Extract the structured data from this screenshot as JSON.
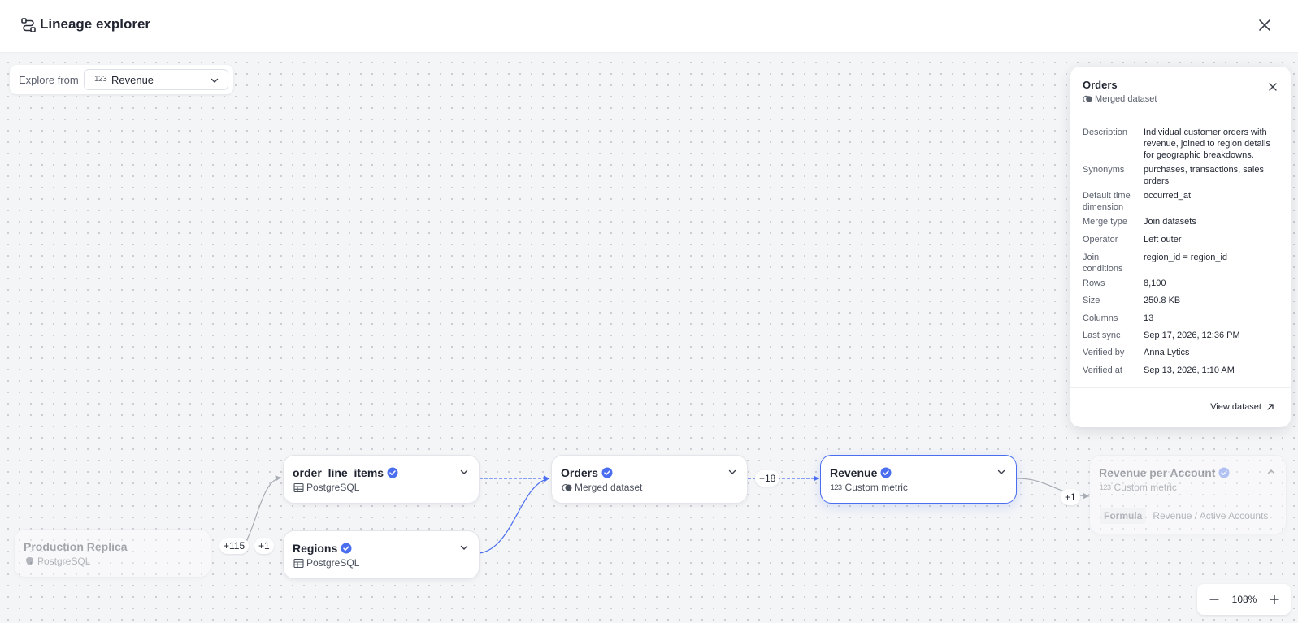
{
  "header": {
    "title": "Lineage explorer",
    "icon": "lineage-icon",
    "close_icon": "close-icon"
  },
  "explore": {
    "label": "Explore from",
    "selected": "Revenue",
    "selected_icon": "metric-123-icon",
    "metric_glyph": "123"
  },
  "nodes": {
    "production_replica": {
      "title": "Production Replica",
      "subtitle": "PostgreSQL"
    },
    "order_line_items": {
      "title": "order_line_items",
      "subtitle": "PostgreSQL"
    },
    "regions": {
      "title": "Regions",
      "subtitle": "PostgreSQL"
    },
    "orders": {
      "title": "Orders",
      "subtitle": "Merged dataset"
    },
    "revenue": {
      "title": "Revenue",
      "subtitle": "Custom metric",
      "glyph": "123"
    },
    "revenue_per_account": {
      "title": "Revenue per Account",
      "subtitle": "Custom metric",
      "glyph": "123",
      "formula_label": "Formula",
      "formula_value": "Revenue / Active Accounts"
    }
  },
  "badges": {
    "b115": "+115",
    "b1_left": "+1",
    "b18": "+18",
    "b1_right": "+1"
  },
  "panel": {
    "title": "Orders",
    "subtitle": "Merged dataset",
    "properties": [
      {
        "key": "Description",
        "value": "Individual customer orders with revenue, joined to region details for geographic breakdowns."
      },
      {
        "key": "Synonyms",
        "value": "purchases, transactions, sales orders"
      },
      {
        "key": "Default time dimension",
        "value": "occurred_at"
      },
      {
        "key": "Merge type",
        "value": "Join datasets"
      },
      {
        "key": "Operator",
        "value": "Left outer"
      },
      {
        "key": "Join conditions",
        "value": "region_id = region_id"
      },
      {
        "key": "Rows",
        "value": "8,100"
      },
      {
        "key": "Size",
        "value": "250.8 KB"
      },
      {
        "key": "Columns",
        "value": "13"
      },
      {
        "key": "Last sync",
        "value": "Sep 17, 2026, 12:36 PM"
      },
      {
        "key": "Verified by",
        "value": "Anna Lytics"
      },
      {
        "key": "Verified at",
        "value": "Sep 13, 2026, 1:10 AM"
      }
    ],
    "view_link": "View dataset"
  },
  "zoom": {
    "value": "108%"
  },
  "colors": {
    "accent": "#4a6ef0",
    "verified": "#4a6ef0",
    "canvas": "#f4f5f7",
    "edge_gray": "#a8acb4"
  }
}
